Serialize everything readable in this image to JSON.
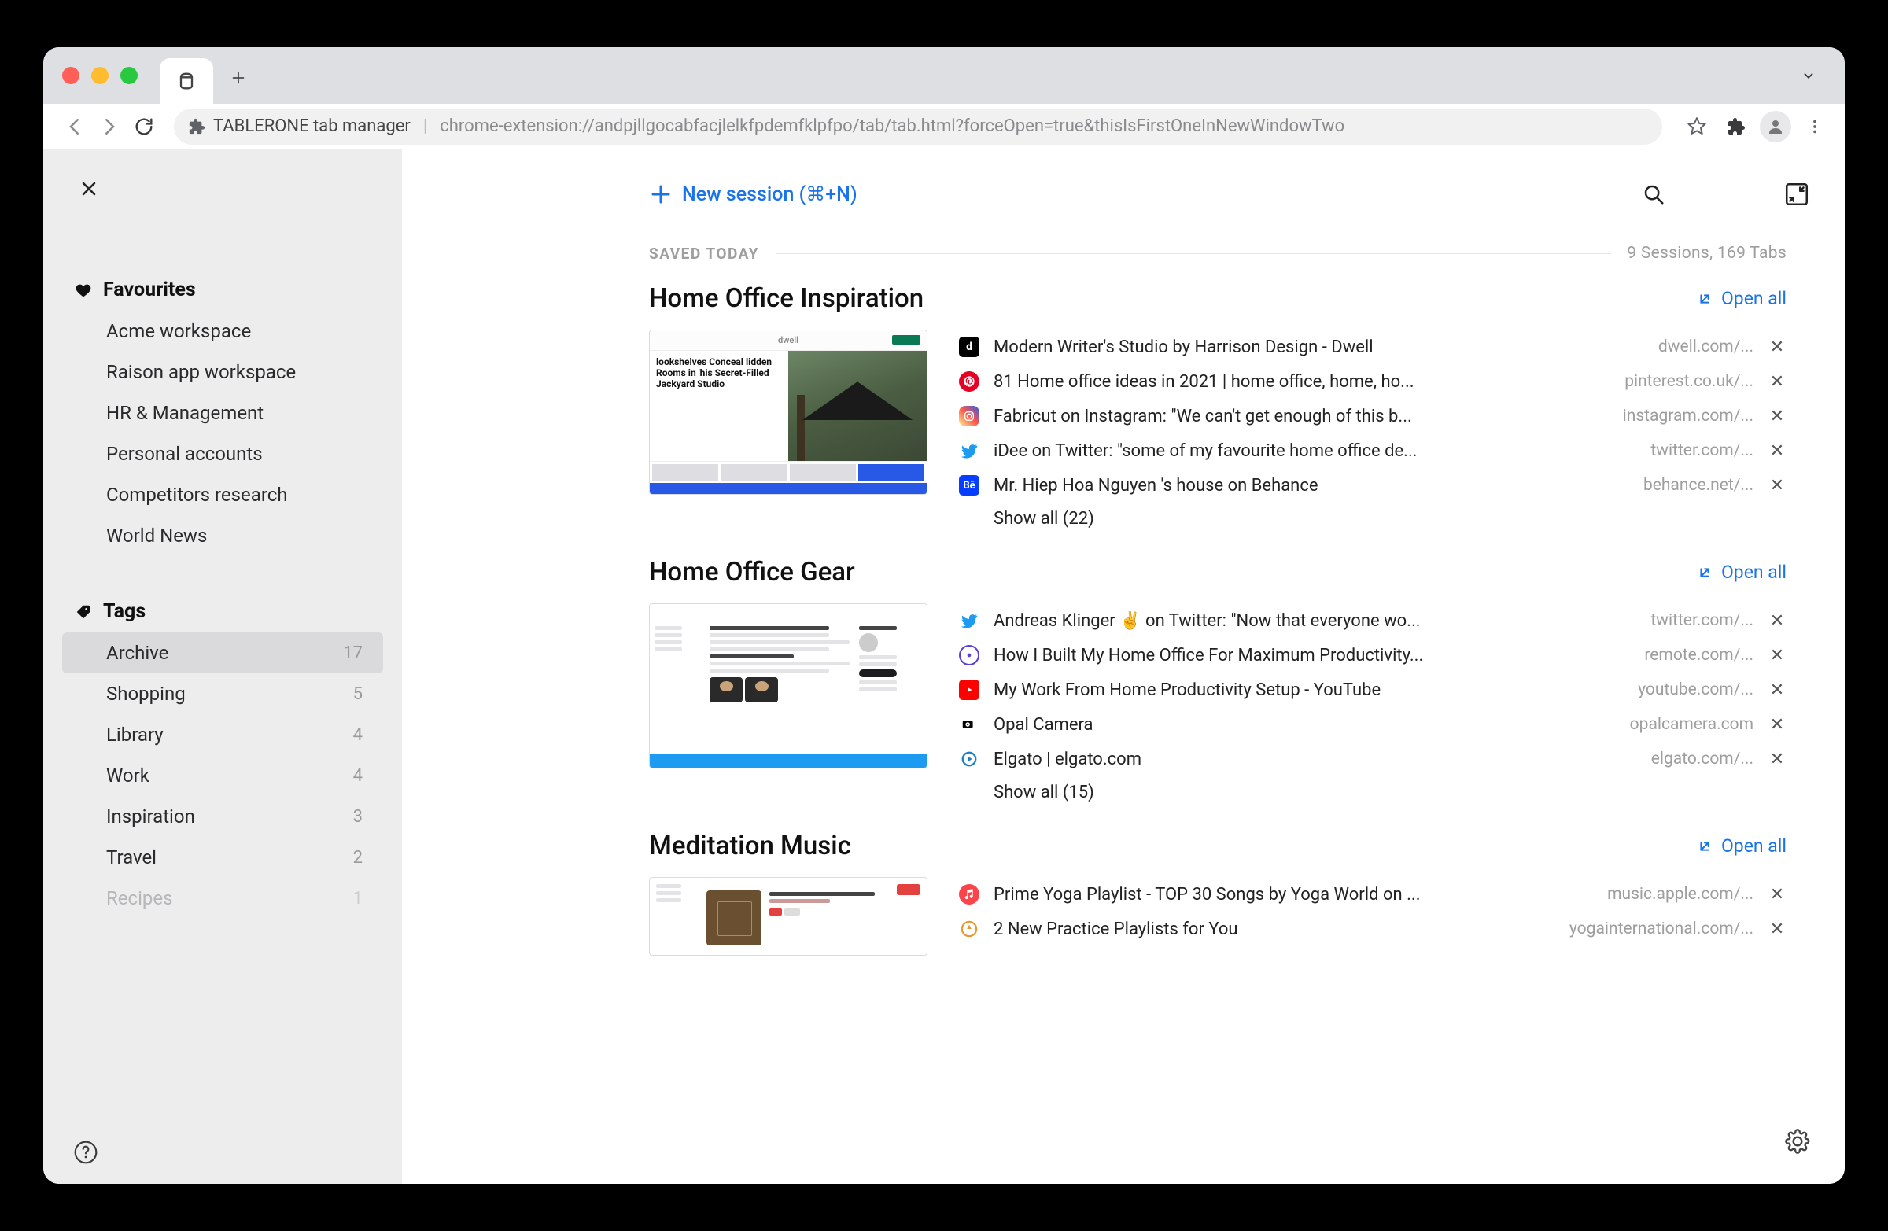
{
  "browser": {
    "tab_title": "TABLERONE tab manager",
    "url": "chrome-extension://andpjllgocabfacjlelkfpdemfklpfpo/tab/tab.html?forceOpen=true&thisIsFirstOneInNewWindowTwo"
  },
  "sidebar": {
    "favourites_header": "Favourites",
    "favourites": [
      {
        "label": "Acme workspace"
      },
      {
        "label": "Raison app workspace"
      },
      {
        "label": "HR & Management"
      },
      {
        "label": "Personal accounts"
      },
      {
        "label": "Competitors research"
      },
      {
        "label": "World News"
      }
    ],
    "tags_header": "Tags",
    "tags": [
      {
        "label": "Archive",
        "count": "17",
        "active": true
      },
      {
        "label": "Shopping",
        "count": "5"
      },
      {
        "label": "Library",
        "count": "4"
      },
      {
        "label": "Work",
        "count": "4"
      },
      {
        "label": "Inspiration",
        "count": "3"
      },
      {
        "label": "Travel",
        "count": "2"
      },
      {
        "label": "Recipes",
        "count": "1",
        "faded": true
      }
    ]
  },
  "main": {
    "new_session_label": "New session (⌘+N)",
    "divider_label": "SAVED TODAY",
    "summary": "9 Sessions, 169 Tabs",
    "open_all_label": "Open all",
    "sessions": [
      {
        "title": "Home Office Inspiration",
        "show_all": "Show all (22)",
        "thumb_texts": {
          "brand": "dwell",
          "headline": "lookshelves Conceal lidden Rooms in 'his Secret-Filled Jackyard Studio"
        },
        "tabs": [
          {
            "favicon": "dwell",
            "title": "Modern Writer's Studio by Harrison Design - Dwell",
            "domain": "dwell.com/..."
          },
          {
            "favicon": "pinterest",
            "title": "81 Home office ideas in 2021 | home office, home, ho...",
            "domain": "pinterest.co.uk/..."
          },
          {
            "favicon": "instagram",
            "title": "Fabricut on Instagram: \"We can't get enough of this b...",
            "domain": "instagram.com/..."
          },
          {
            "favicon": "twitter",
            "title": "iDee on Twitter: \"some of my favourite home office de...",
            "domain": "twitter.com/..."
          },
          {
            "favicon": "behance",
            "title": "Mr. Hiep Hoa Nguyen 's house on Behance",
            "domain": "behance.net/..."
          }
        ]
      },
      {
        "title": "Home Office Gear",
        "show_all": "Show all (15)",
        "tabs": [
          {
            "favicon": "twitter",
            "title": "Andreas Klinger ✌️ on Twitter: \"Now that everyone wo...",
            "domain": "twitter.com/..."
          },
          {
            "favicon": "orbit",
            "title": "How I Built My Home Office For Maximum Productivity...",
            "domain": "remote.com/..."
          },
          {
            "favicon": "youtube",
            "title": "My Work From Home Productivity Setup - YouTube",
            "domain": "youtube.com/..."
          },
          {
            "favicon": "opal",
            "title": "Opal Camera",
            "domain": "opalcamera.com"
          },
          {
            "favicon": "elgato",
            "title": "Elgato | elgato.com",
            "domain": "elgato.com/..."
          }
        ]
      },
      {
        "title": "Meditation Music",
        "tabs": [
          {
            "favicon": "applemusic",
            "title": "Prime Yoga Playlist - TOP 30 Songs by Yoga World on ...",
            "domain": "music.apple.com/..."
          },
          {
            "favicon": "yi",
            "title": "2 New Practice Playlists for You",
            "domain": "yogainternational.com/..."
          }
        ]
      }
    ]
  }
}
